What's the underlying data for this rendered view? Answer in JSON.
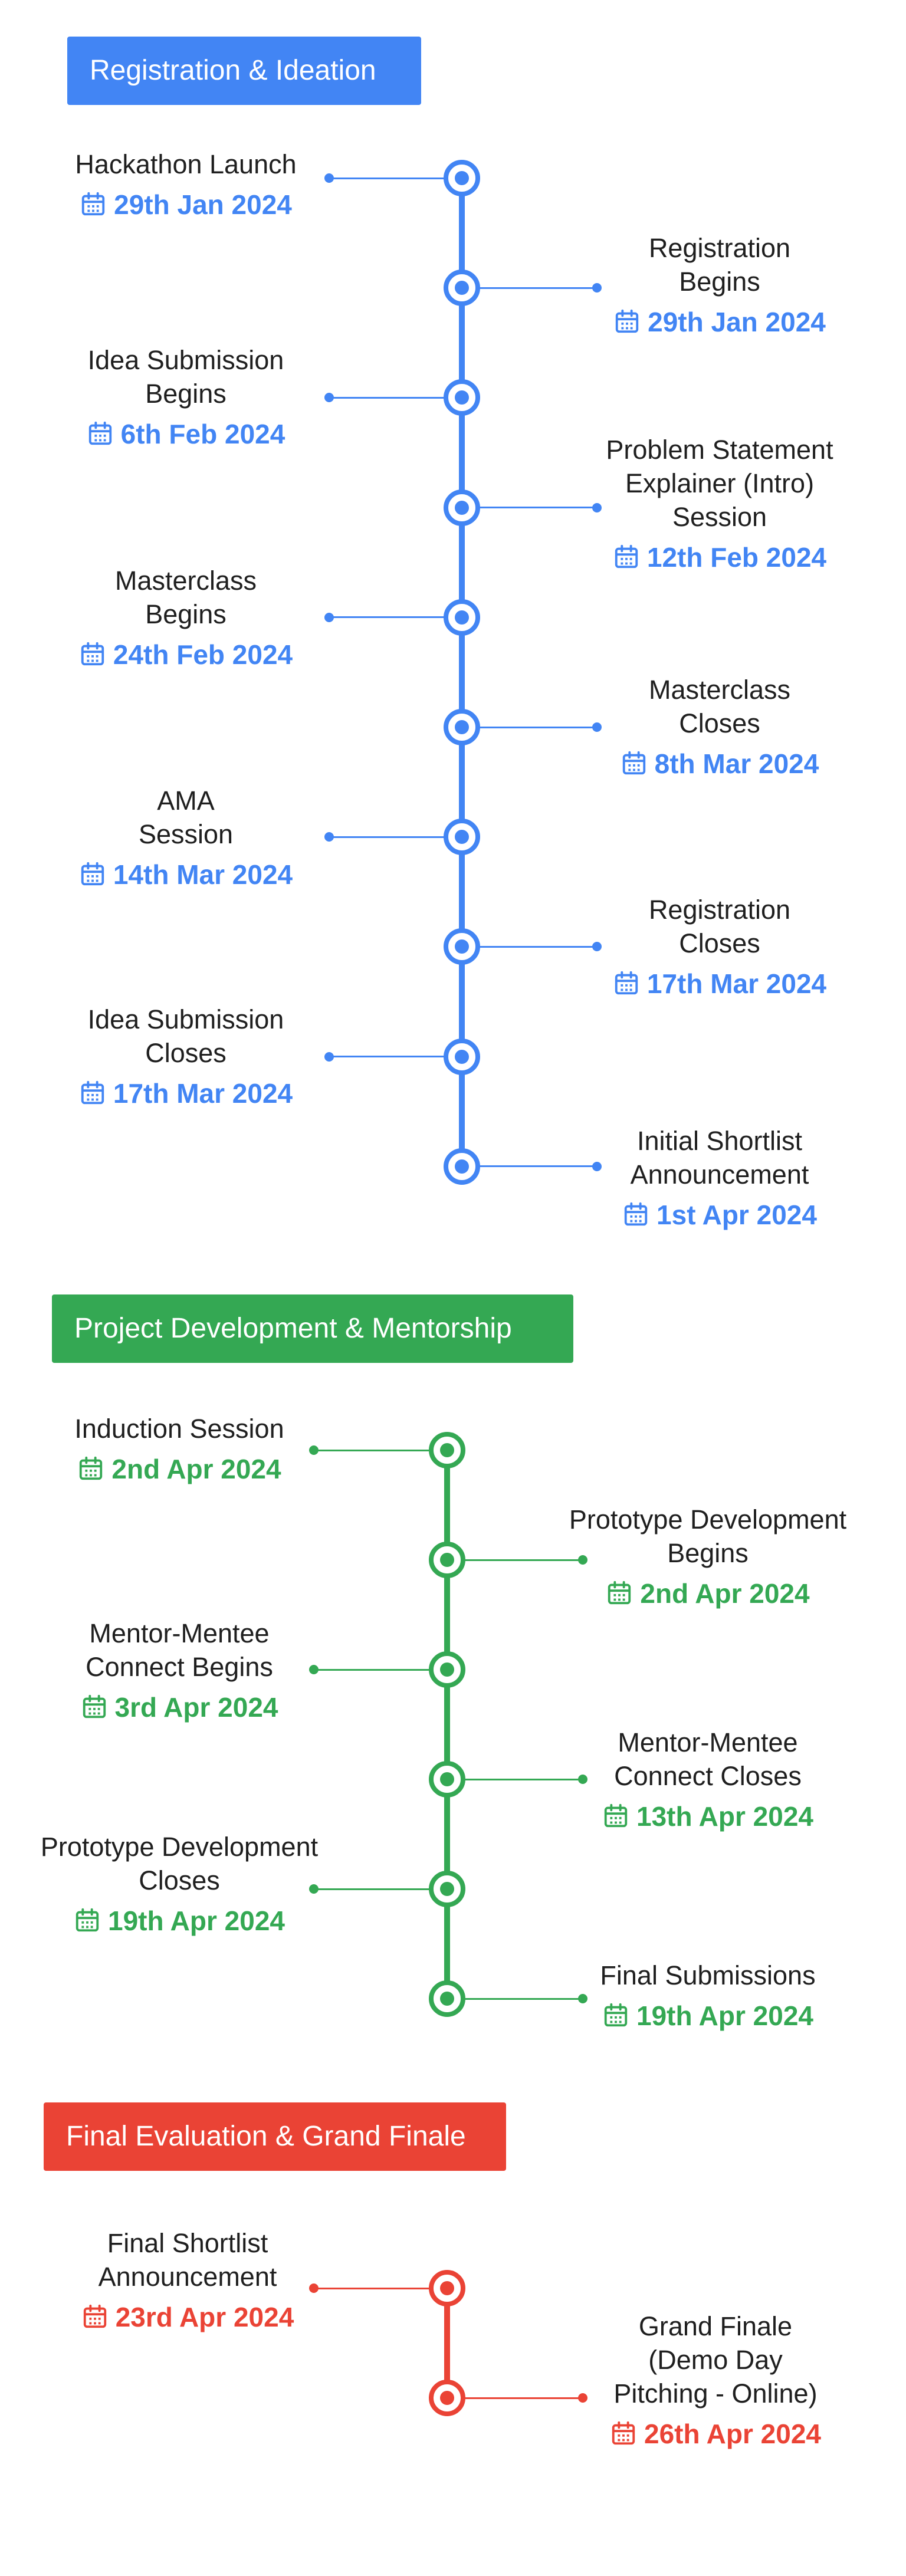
{
  "colors": {
    "blue": "#4285f4",
    "green": "#34a853",
    "red": "#ea4335",
    "text": "#1f1f1f"
  },
  "icons": {
    "date": "calendar-icon",
    "node": "timeline-node-icon"
  },
  "sections": [
    {
      "name": "registration-ideation",
      "title": "Registration & Ideation",
      "color": "#4285f4",
      "events": [
        {
          "title": "Hackathon Launch",
          "date": "29th Jan 2024",
          "side": "left"
        },
        {
          "title": "Registration Begins",
          "date": "29th Jan 2024",
          "side": "right"
        },
        {
          "title": "Idea Submission Begins",
          "date": "6th Feb 2024",
          "side": "left"
        },
        {
          "title": "Problem Statement Explainer (Intro) Session",
          "date": "12th Feb 2024",
          "side": "right"
        },
        {
          "title": "Masterclass Begins",
          "date": "24th Feb 2024",
          "side": "left"
        },
        {
          "title": "Masterclass Closes",
          "date": "8th Mar 2024",
          "side": "right"
        },
        {
          "title": "AMA Session",
          "date": "14th Mar 2024",
          "side": "left"
        },
        {
          "title": "Registration Closes",
          "date": "17th Mar 2024",
          "side": "right"
        },
        {
          "title": "Idea Submission Closes",
          "date": "17th Mar 2024",
          "side": "left"
        },
        {
          "title": "Initial Shortlist Announcement",
          "date": "1st Apr 2024",
          "side": "right"
        }
      ]
    },
    {
      "name": "project-development-mentorship",
      "title": "Project Development & Mentorship",
      "color": "#34a853",
      "events": [
        {
          "title": "Induction Session",
          "date": "2nd Apr 2024",
          "side": "left"
        },
        {
          "title": "Prototype Development Begins",
          "date": "2nd Apr 2024",
          "side": "right"
        },
        {
          "title": "Mentor-Mentee Connect Begins",
          "date": "3rd Apr 2024",
          "side": "left"
        },
        {
          "title": "Mentor-Mentee Connect Closes",
          "date": "13th Apr 2024",
          "side": "right"
        },
        {
          "title": "Prototype Development Closes",
          "date": "19th Apr 2024",
          "side": "left"
        },
        {
          "title": "Final Submissions",
          "date": "19th Apr 2024",
          "side": "right"
        }
      ]
    },
    {
      "name": "final-evaluation-grand-finale",
      "title": "Final Evaluation & Grand Finale",
      "color": "#ea4335",
      "events": [
        {
          "title": "Final Shortlist Announcement",
          "date": "23rd Apr 2024",
          "side": "left"
        },
        {
          "title": "Grand Finale (Demo Day Pitching - Online)",
          "date": "26th Apr 2024",
          "side": "right"
        }
      ]
    }
  ]
}
